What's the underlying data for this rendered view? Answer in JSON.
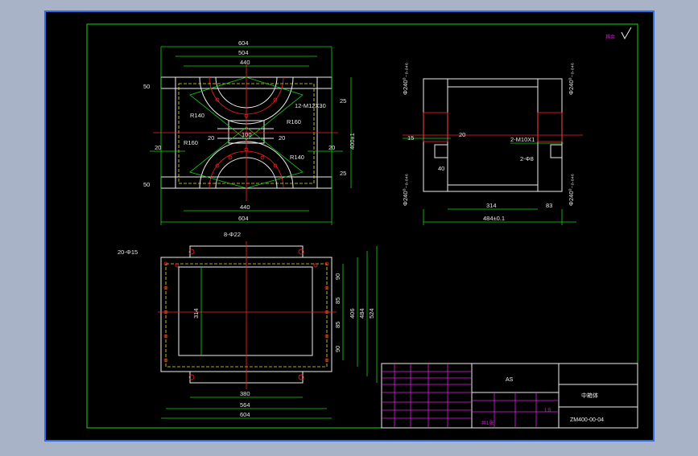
{
  "drawing": {
    "roughness_mark": "其余",
    "top_view": {
      "dims_top": [
        "604",
        "504",
        "440"
      ],
      "dims_bottom": [
        "440",
        "604"
      ],
      "left_dims": [
        "50",
        "20",
        "20",
        "50"
      ],
      "labels": [
        "R140",
        "R160",
        "R160",
        "R140",
        "12-M12X30",
        "100",
        "20",
        "20",
        "25",
        "25",
        "400±1"
      ]
    },
    "side_view": {
      "labels": [
        "Φ240⁰₋₀.₀₄₆",
        "Φ240⁰₋₀.₀₄₆",
        "Φ240⁰₋₀.₀₄₆",
        "Φ240⁰₋₀.₀₄₆",
        "15",
        "20",
        "40",
        "2-M10X1",
        "2-Φ8",
        "314",
        "83",
        "484±0.1"
      ]
    },
    "plan_view": {
      "labels": [
        "20-Φ15",
        "8-Φ22",
        "314",
        "90",
        "85",
        "85",
        "90",
        "406",
        "484",
        "524",
        "380",
        "564",
        "604"
      ]
    },
    "title_block": {
      "material": "AS",
      "part_name": "中箱体",
      "drawing_no": "ZM400-00-04",
      "scale": "1:5",
      "sheet": "共1张"
    }
  }
}
